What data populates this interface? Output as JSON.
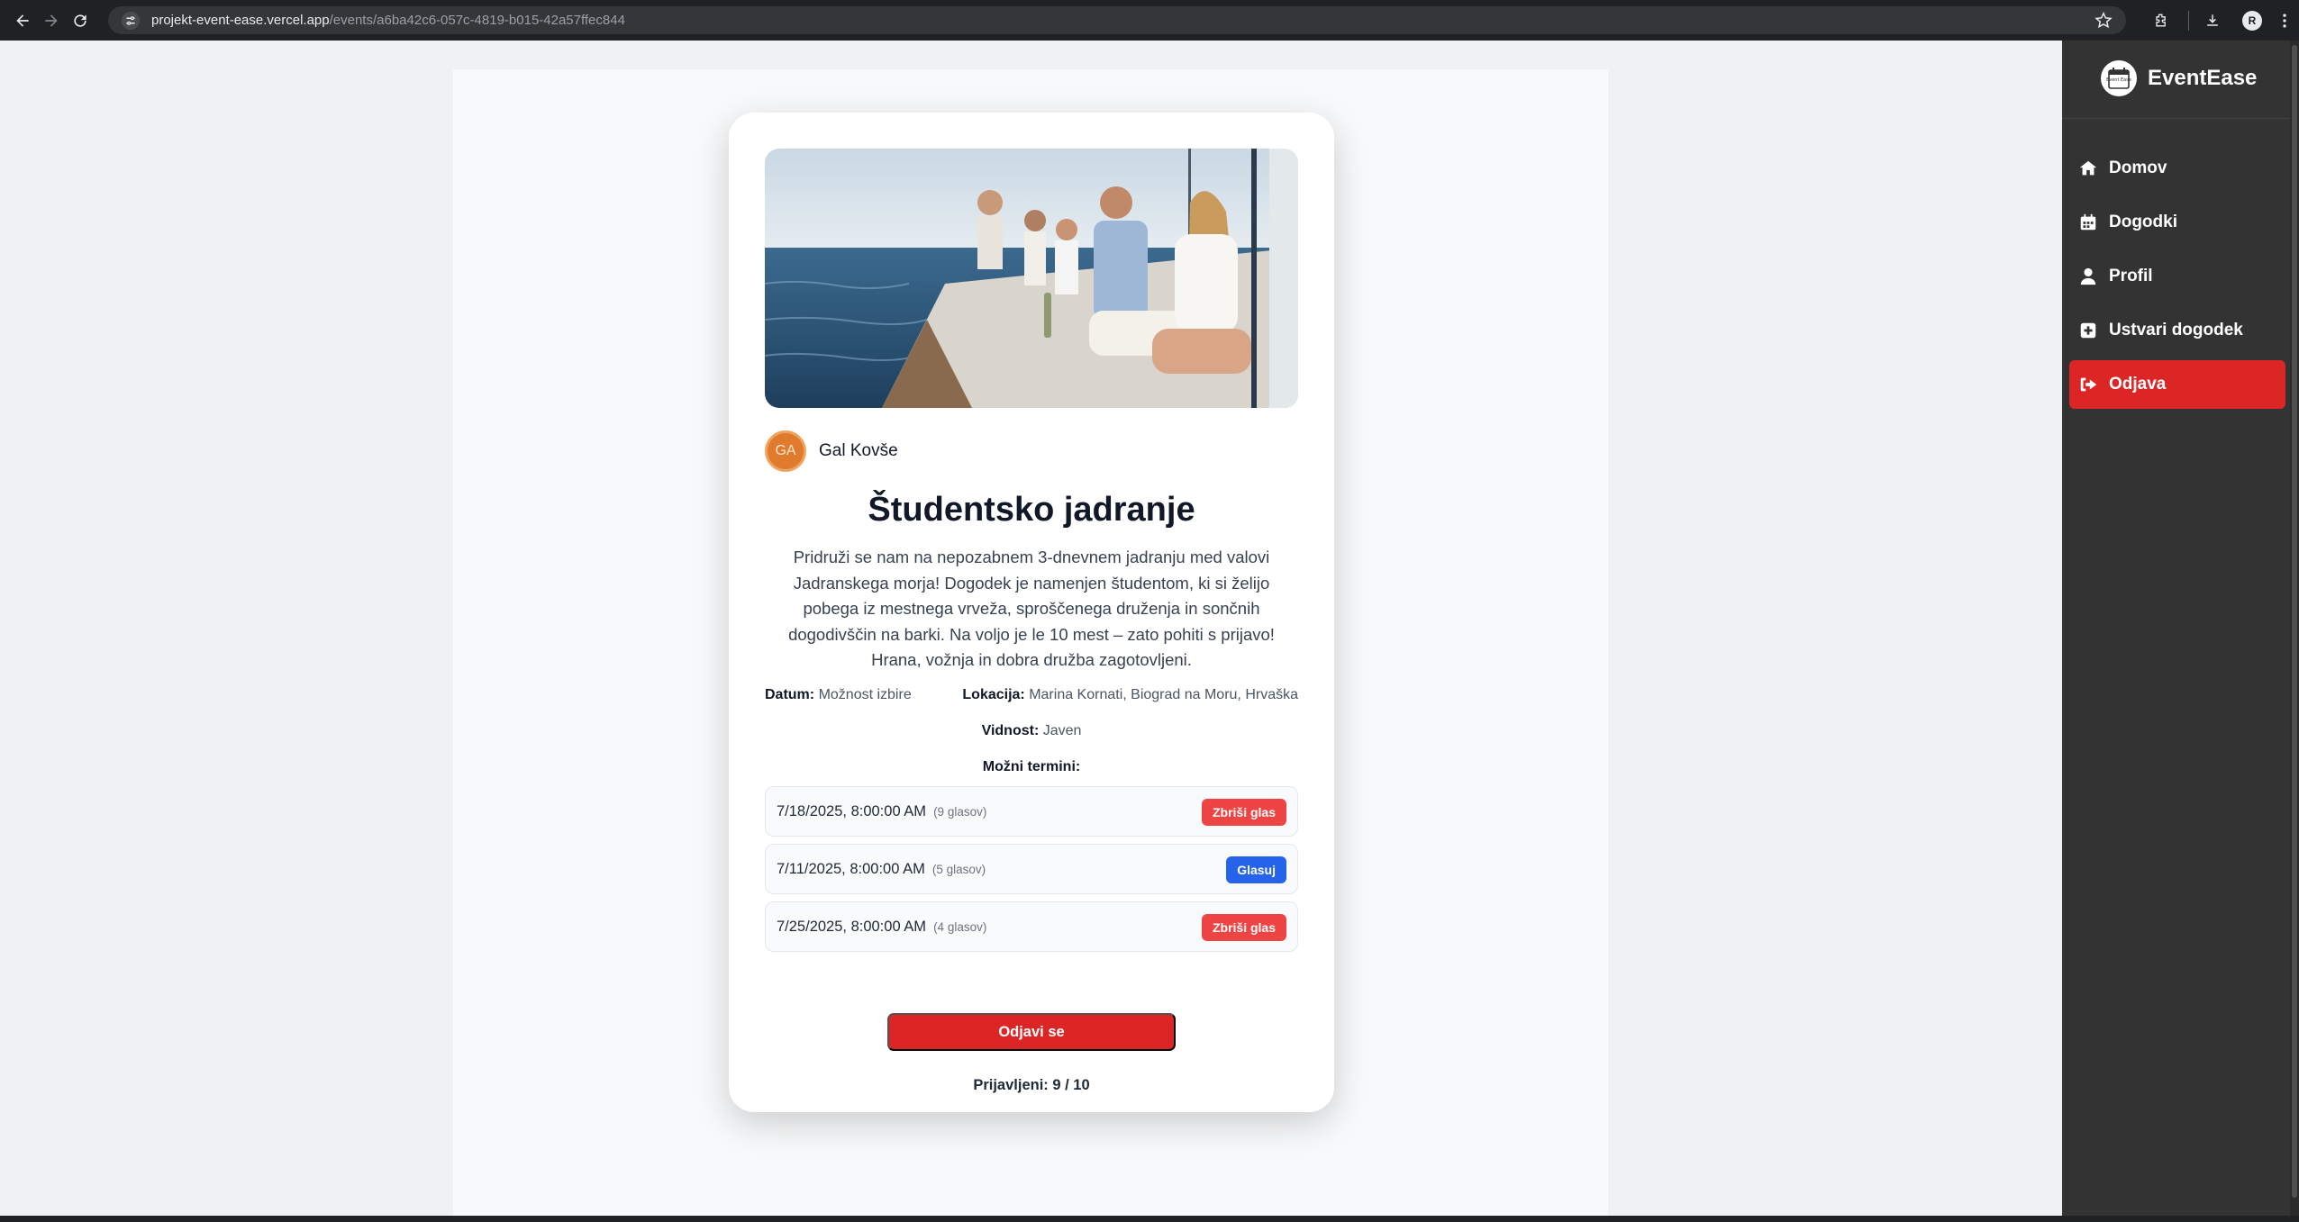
{
  "browser": {
    "url_host": "projekt-event-ease.vercel.app",
    "url_path": "/events/a6ba42c6-057c-4819-b015-42a57ffec844",
    "profile_initial": "R"
  },
  "sidebar": {
    "brand": "EventEase",
    "logo_text": "Event Ease",
    "items": [
      {
        "label": "Domov",
        "icon": "home-icon"
      },
      {
        "label": "Dogodki",
        "icon": "calendar-icon"
      },
      {
        "label": "Profil",
        "icon": "user-icon"
      },
      {
        "label": "Ustvari dogodek",
        "icon": "plus-square-icon"
      },
      {
        "label": "Odjava",
        "icon": "sign-out-icon"
      }
    ]
  },
  "event": {
    "author_initials": "GA",
    "author_name": "Gal Kovše",
    "title": "Študentsko jadranje",
    "description": "Pridruži se nam na nepozabnem 3-dnevnem jadranju med valovi Jadranskega morja! Dogodek je namenjen študentom, ki si želijo pobega iz mestnega vrveža, sproščenega druženja in sončnih dogodivščin na barki. Na voljo je le 10 mest – zato pohiti s prijavo! Hrana, vožnja in dobra družba zagotovljeni.",
    "date_label": "Datum:",
    "date_value": "Možnost izbire",
    "location_label": "Lokacija:",
    "location_value": "Marina Kornati, Biograd na Moru, Hrvaška",
    "visibility_label": "Vidnost:",
    "visibility_value": "Javen",
    "options_heading": "Možni termini:",
    "options": [
      {
        "date": "7/18/2025, 8:00:00 AM",
        "votes": "(9 glasov)",
        "action": "Zbriši glas",
        "color": "#ef4444"
      },
      {
        "date": "7/11/2025, 8:00:00 AM",
        "votes": "(5 glasov)",
        "action": "Glasuj",
        "color": "#2563eb"
      },
      {
        "date": "7/25/2025, 8:00:00 AM",
        "votes": "(4 glasov)",
        "action": "Zbriši glas",
        "color": "#ef4444"
      }
    ],
    "unsubscribe_label": "Odjavi se",
    "registered_text": "Prijavljeni: 9 / 10"
  },
  "colors": {
    "accent_red": "#dc2626",
    "vote_blue": "#2563eb",
    "sidebar_bg": "#333333",
    "avatar_orange": "#e07a2c"
  }
}
